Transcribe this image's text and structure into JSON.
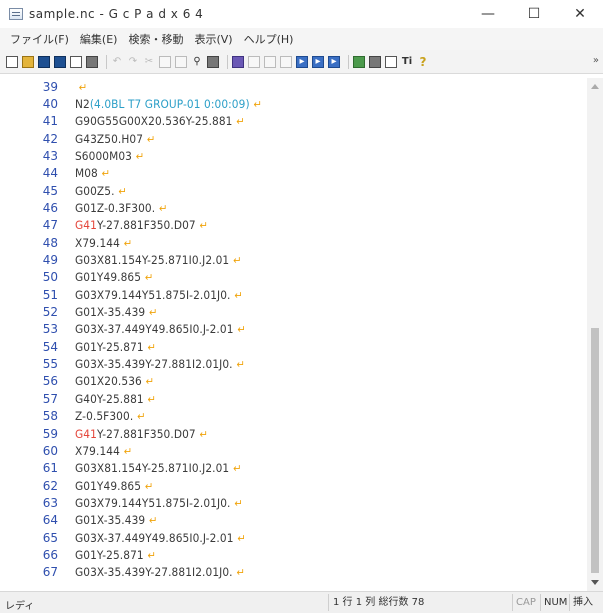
{
  "window": {
    "title": "sample.nc - G c P a d  x 6 4",
    "minimize": "—",
    "maximize": "☐",
    "close": "✕"
  },
  "menu": [
    "ファイル(F)",
    "編集(E)",
    "検索・移動",
    "表示(V)",
    "ヘルプ(H)"
  ],
  "toolbar": {
    "icons": [
      "new-file-icon",
      "open-folder-icon",
      "save-icon",
      "save-all-icon",
      "export-icon",
      "print-icon",
      "undo-icon",
      "redo-icon",
      "cut-icon",
      "copy-icon",
      "paste-icon",
      "find-icon",
      "replace-icon",
      "bookmark-icon",
      "doc-icon",
      "doc-icon",
      "doc-icon",
      "run-icon",
      "forward-icon",
      "forward-icon",
      "settings-icon",
      "print-preview-icon",
      "preview-icon",
      "font-icon",
      "help-icon"
    ],
    "overflow": "»"
  },
  "editor": {
    "eol_marker": "↵",
    "lines": [
      {
        "n": "39",
        "segs": [
          {
            "t": "",
            "c": "normal"
          }
        ]
      },
      {
        "n": "40",
        "segs": [
          {
            "t": "N2",
            "c": "normal"
          },
          {
            "t": "(4.0BL T7 GROUP-01 0:00:09)",
            "c": "cyan"
          }
        ]
      },
      {
        "n": "41",
        "segs": [
          {
            "t": "G90G55G00X20.536Y-25.881",
            "c": "normal"
          }
        ]
      },
      {
        "n": "42",
        "segs": [
          {
            "t": "G43Z50.H07",
            "c": "normal"
          }
        ]
      },
      {
        "n": "43",
        "segs": [
          {
            "t": "S6000M03",
            "c": "normal"
          }
        ]
      },
      {
        "n": "44",
        "segs": [
          {
            "t": "M08",
            "c": "normal"
          }
        ]
      },
      {
        "n": "45",
        "segs": [
          {
            "t": "G00Z5.",
            "c": "normal"
          }
        ]
      },
      {
        "n": "46",
        "segs": [
          {
            "t": "G01Z-0.3F300.",
            "c": "normal"
          }
        ]
      },
      {
        "n": "47",
        "segs": [
          {
            "t": "G41",
            "c": "red"
          },
          {
            "t": "Y-27.881F350.D07",
            "c": "normal"
          }
        ]
      },
      {
        "n": "48",
        "segs": [
          {
            "t": "X79.144",
            "c": "normal"
          }
        ]
      },
      {
        "n": "49",
        "segs": [
          {
            "t": "G03X81.154Y-25.871I0.J2.01",
            "c": "normal"
          }
        ]
      },
      {
        "n": "50",
        "segs": [
          {
            "t": "G01Y49.865",
            "c": "normal"
          }
        ]
      },
      {
        "n": "51",
        "segs": [
          {
            "t": "G03X79.144Y51.875I-2.01J0.",
            "c": "normal"
          }
        ]
      },
      {
        "n": "52",
        "segs": [
          {
            "t": "G01X-35.439",
            "c": "normal"
          }
        ]
      },
      {
        "n": "53",
        "segs": [
          {
            "t": "G03X-37.449Y49.865I0.J-2.01",
            "c": "normal"
          }
        ]
      },
      {
        "n": "54",
        "segs": [
          {
            "t": "G01Y-25.871",
            "c": "normal"
          }
        ]
      },
      {
        "n": "55",
        "segs": [
          {
            "t": "G03X-35.439Y-27.881I2.01J0.",
            "c": "normal"
          }
        ]
      },
      {
        "n": "56",
        "segs": [
          {
            "t": "G01X20.536",
            "c": "normal"
          }
        ]
      },
      {
        "n": "57",
        "segs": [
          {
            "t": "G40Y-25.881",
            "c": "normal"
          }
        ]
      },
      {
        "n": "58",
        "segs": [
          {
            "t": "Z-0.5F300.",
            "c": "normal"
          }
        ]
      },
      {
        "n": "59",
        "segs": [
          {
            "t": "G41",
            "c": "red"
          },
          {
            "t": "Y-27.881F350.D07",
            "c": "normal"
          }
        ]
      },
      {
        "n": "60",
        "segs": [
          {
            "t": "X79.144",
            "c": "normal"
          }
        ]
      },
      {
        "n": "61",
        "segs": [
          {
            "t": "G03X81.154Y-25.871I0.J2.01",
            "c": "normal"
          }
        ]
      },
      {
        "n": "62",
        "segs": [
          {
            "t": "G01Y49.865",
            "c": "normal"
          }
        ]
      },
      {
        "n": "63",
        "segs": [
          {
            "t": "G03X79.144Y51.875I-2.01J0.",
            "c": "normal"
          }
        ]
      },
      {
        "n": "64",
        "segs": [
          {
            "t": "G01X-35.439",
            "c": "normal"
          }
        ]
      },
      {
        "n": "65",
        "segs": [
          {
            "t": "G03X-37.449Y49.865I0.J-2.01",
            "c": "normal"
          }
        ]
      },
      {
        "n": "66",
        "segs": [
          {
            "t": "G01Y-25.871",
            "c": "normal"
          }
        ]
      },
      {
        "n": "67",
        "segs": [
          {
            "t": "G03X-35.439Y-27.881I2.01J0.",
            "c": "normal"
          }
        ]
      }
    ]
  },
  "status": {
    "mode": "レディ",
    "position": "1 行  1 列  総行数 78",
    "cap": "CAP",
    "num": "NUM",
    "ins": "挿入"
  }
}
